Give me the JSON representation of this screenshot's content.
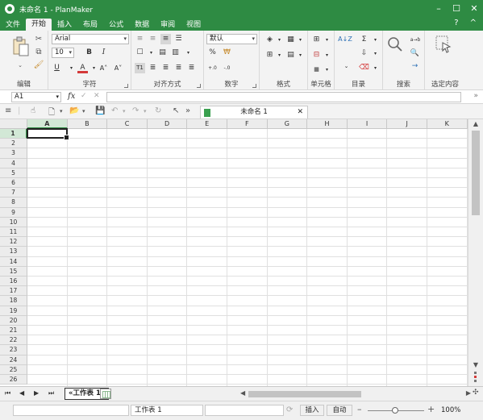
{
  "window": {
    "title": "未命名 1 - PlanMaker",
    "controls": [
      "–",
      "☐",
      "✕"
    ]
  },
  "menu": {
    "items": [
      "文件",
      "开始",
      "插入",
      "布局",
      "公式",
      "数据",
      "审阅",
      "视图"
    ],
    "active": "开始",
    "help": "?",
    "collapse": "^"
  },
  "ribbon": {
    "font_name": "Arial",
    "font_size": "10",
    "number_format": "默认",
    "bold": "B",
    "italic": "I",
    "underline": "U",
    "font_color": "A",
    "grow_font": "A˄",
    "shrink_font": "A˅",
    "superscript": "T1",
    "percent": "%",
    "decimal_inc": "+.0",
    "decimal_dec": "-.0",
    "sort": "A↓Z",
    "sum": "Σ",
    "replace": "a→b",
    "groups": {
      "edit": "编辑",
      "font": "字符",
      "align": "对齐方式",
      "number": "数字",
      "style": "格式",
      "cells": "单元格",
      "outline": "目录",
      "search": "搜索",
      "selection": "选定内容"
    }
  },
  "formula_bar": {
    "cell_ref": "A1",
    "fx": "fx",
    "confirm": "✓",
    "cancel": "✕",
    "value": "",
    "expand": "»"
  },
  "quickbar": {
    "more": "»"
  },
  "document_tab": {
    "title": "未命名 1",
    "close": "✕"
  },
  "grid": {
    "columns": [
      "A",
      "B",
      "C",
      "D",
      "E",
      "F",
      "G",
      "H",
      "I",
      "J",
      "K"
    ],
    "rows": [
      "1",
      "2",
      "3",
      "4",
      "5",
      "6",
      "7",
      "8",
      "9",
      "10",
      "11",
      "12",
      "13",
      "14",
      "15",
      "16",
      "17",
      "18",
      "19",
      "20",
      "21",
      "22",
      "23",
      "24",
      "25",
      "26"
    ],
    "active_cell": "A1"
  },
  "sheets": {
    "tabs": [
      "«工作表 1»"
    ],
    "nav": [
      "⏮",
      "◀",
      "▶",
      "⏭"
    ]
  },
  "status": {
    "sheet_name": "工作表 1",
    "insert_mode": "插入",
    "calc_mode": "自动",
    "zoom": "100%",
    "zoom_level_percent": 100
  }
}
